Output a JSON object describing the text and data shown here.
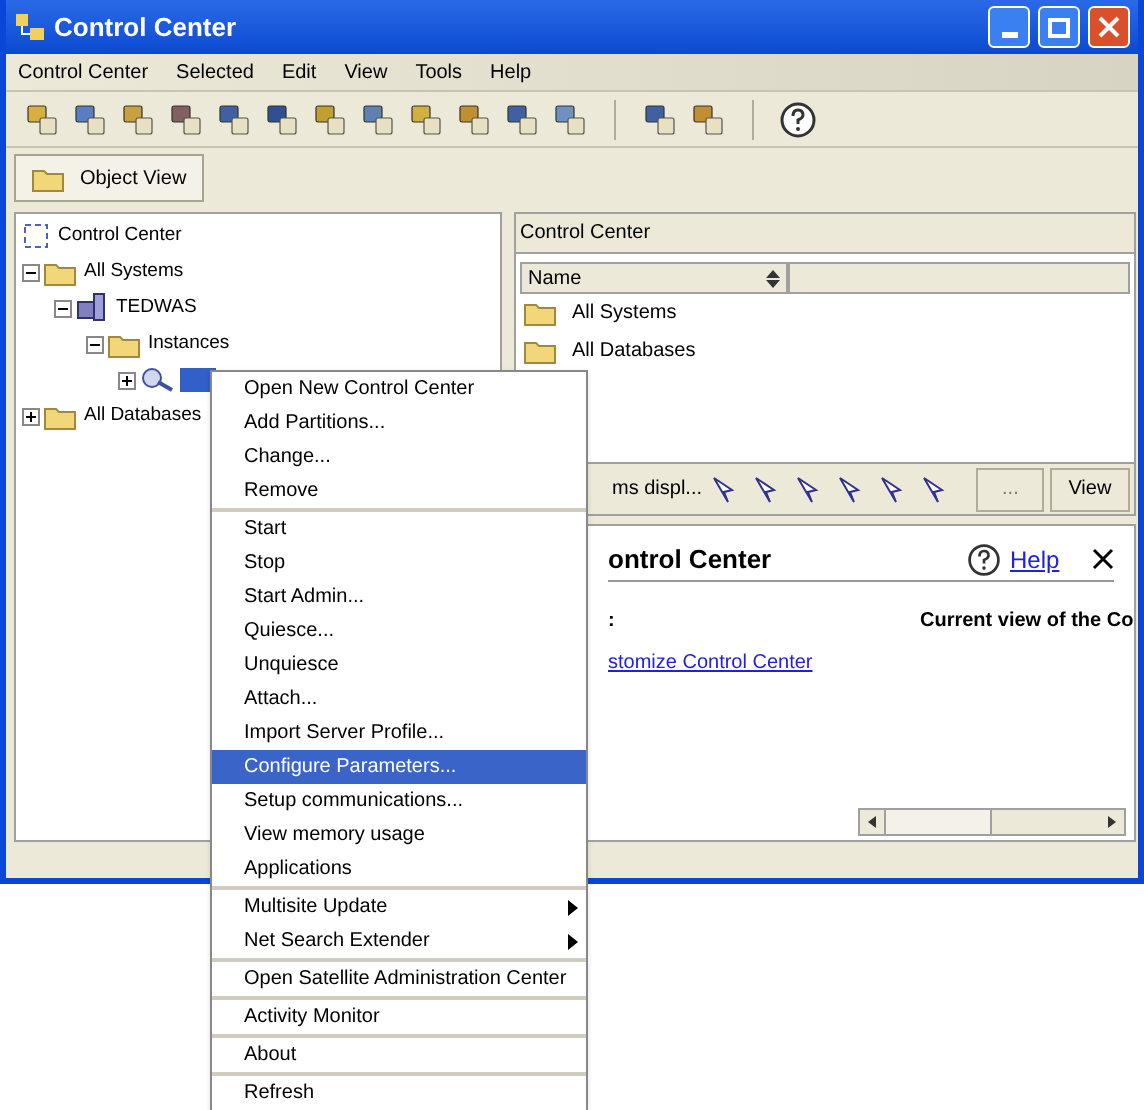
{
  "window": {
    "title": "Control Center"
  },
  "menu_bar": [
    "Control Center",
    "Selected",
    "Edit",
    "View",
    "Tools",
    "Help"
  ],
  "view_tab": {
    "label": "Object View",
    "selected": true
  },
  "tree": [
    {
      "label": "Control Center",
      "selected": false,
      "children": [
        {
          "label": "All Systems",
          "selected": false,
          "expanded": true,
          "children": [
            {
              "label": "TEDWAS",
              "selected": false,
              "expanded": true,
              "children": [
                {
                  "label": "Instances",
                  "selected": false,
                  "expanded": true,
                  "children": [
                    {
                      "selected": true,
                      "expanded": false
                    }
                  ]
                }
              ]
            }
          ]
        },
        {
          "label": "All Databases",
          "selected": false,
          "expanded": false
        }
      ]
    }
  ],
  "contents": {
    "title": "Control Center",
    "column": "Name",
    "rows": [
      "All Systems",
      "All Databases"
    ],
    "items_displayed": "ms displ...",
    "more_button": "...",
    "view_button": "View"
  },
  "info": {
    "heading": "ontrol Center",
    "help": "Help",
    "label": ":",
    "current_view": "Current view of the Co",
    "link": "stomize Control Center"
  },
  "context_menu": [
    [
      {
        "label": "Open New Control Center",
        "selected": false
      },
      {
        "label": "Add Partitions...",
        "selected": false
      },
      {
        "label": "Change...",
        "selected": false
      },
      {
        "label": "Remove",
        "selected": false
      }
    ],
    [
      {
        "label": "Start",
        "selected": false
      },
      {
        "label": "Stop",
        "selected": false
      },
      {
        "label": "Start Admin...",
        "selected": false
      },
      {
        "label": "Quiesce...",
        "selected": false
      },
      {
        "label": "Unquiesce",
        "selected": false
      },
      {
        "label": "Attach...",
        "selected": false
      },
      {
        "label": "Import Server Profile...",
        "selected": false
      },
      {
        "label": "Configure Parameters...",
        "selected": true
      },
      {
        "label": "Setup communications...",
        "selected": false
      },
      {
        "label": "View memory usage",
        "selected": false
      },
      {
        "label": "Applications",
        "selected": false
      }
    ],
    [
      {
        "label": "Multisite Update",
        "selected": false,
        "submenu": true
      },
      {
        "label": "Net Search Extender",
        "selected": false,
        "submenu": true
      }
    ],
    [
      {
        "label": "Open Satellite Administration Center",
        "selected": false
      }
    ],
    [
      {
        "label": "Activity Monitor",
        "selected": false
      }
    ],
    [
      {
        "label": "About",
        "selected": false
      }
    ],
    [
      {
        "label": "Refresh",
        "selected": false
      }
    ]
  ]
}
